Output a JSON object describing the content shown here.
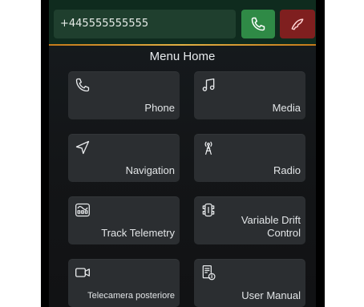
{
  "call_bar": {
    "phone_number": "+445555555555",
    "call_icon": "phone-icon",
    "hangup_icon": "phone-hangup-icon",
    "call_color": "#2f8a46",
    "hangup_color": "#7f1f1f"
  },
  "menu": {
    "title": "Menu Home",
    "tiles": [
      {
        "label": "Phone",
        "icon": "phone-icon"
      },
      {
        "label": "Media",
        "icon": "music-note-icon"
      },
      {
        "label": "Navigation",
        "icon": "navigation-arrow-icon"
      },
      {
        "label": "Radio",
        "icon": "radio-tower-icon"
      },
      {
        "label": "Track Telemetry",
        "icon": "telemetry-icon"
      },
      {
        "label": "Variable Drift Control",
        "icon": "drift-control-icon"
      },
      {
        "label": "Telecamera posteriore",
        "icon": "rear-camera-icon"
      },
      {
        "label": "User Manual",
        "icon": "user-manual-icon"
      }
    ]
  },
  "accent_color": "#d9a23a"
}
